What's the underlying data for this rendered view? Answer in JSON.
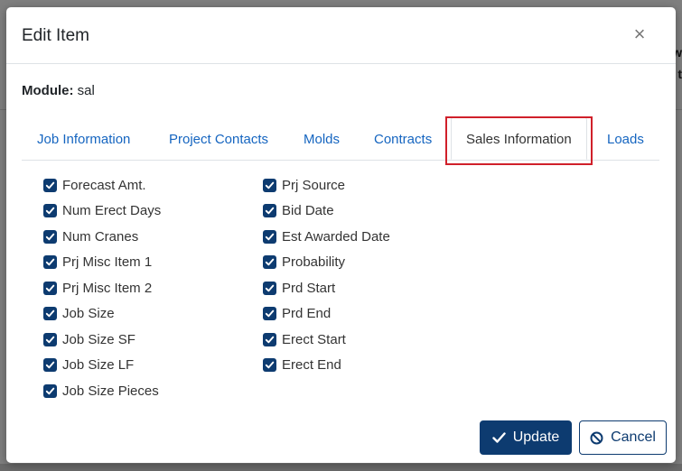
{
  "backdrop": {
    "fragment_1": "w",
    "fragment_2": "t"
  },
  "dialog": {
    "title": "Edit Item",
    "close_glyph": "×"
  },
  "module": {
    "label": "Module:",
    "value": "sal"
  },
  "tabs": [
    {
      "label": "Job Information",
      "active": false
    },
    {
      "label": "Project Contacts",
      "active": false
    },
    {
      "label": "Molds",
      "active": false
    },
    {
      "label": "Contracts",
      "active": false
    },
    {
      "label": "Sales Information",
      "active": true
    },
    {
      "label": "Loads",
      "active": false
    }
  ],
  "checkboxes": {
    "left": [
      {
        "label": "Forecast Amt.",
        "checked": true
      },
      {
        "label": "Num Erect Days",
        "checked": true
      },
      {
        "label": "Num Cranes",
        "checked": true
      },
      {
        "label": "Prj Misc Item 1",
        "checked": true
      },
      {
        "label": "Prj Misc Item 2",
        "checked": true
      },
      {
        "label": "Job Size",
        "checked": true
      },
      {
        "label": "Job Size SF",
        "checked": true
      },
      {
        "label": "Job Size LF",
        "checked": true
      },
      {
        "label": "Job Size Pieces",
        "checked": true
      }
    ],
    "right": [
      {
        "label": "Prj Source",
        "checked": true
      },
      {
        "label": "Bid Date",
        "checked": true
      },
      {
        "label": "Est Awarded Date",
        "checked": true
      },
      {
        "label": "Probability",
        "checked": true
      },
      {
        "label": "Prd Start",
        "checked": true
      },
      {
        "label": "Prd End",
        "checked": true
      },
      {
        "label": "Erect Start",
        "checked": true
      },
      {
        "label": "Erect End",
        "checked": true
      }
    ]
  },
  "buttons": {
    "update_label": "Update",
    "cancel_label": "Cancel"
  },
  "colors": {
    "primary": "#0d3b70",
    "link": "#1565c0",
    "highlight": "#d0202a"
  }
}
